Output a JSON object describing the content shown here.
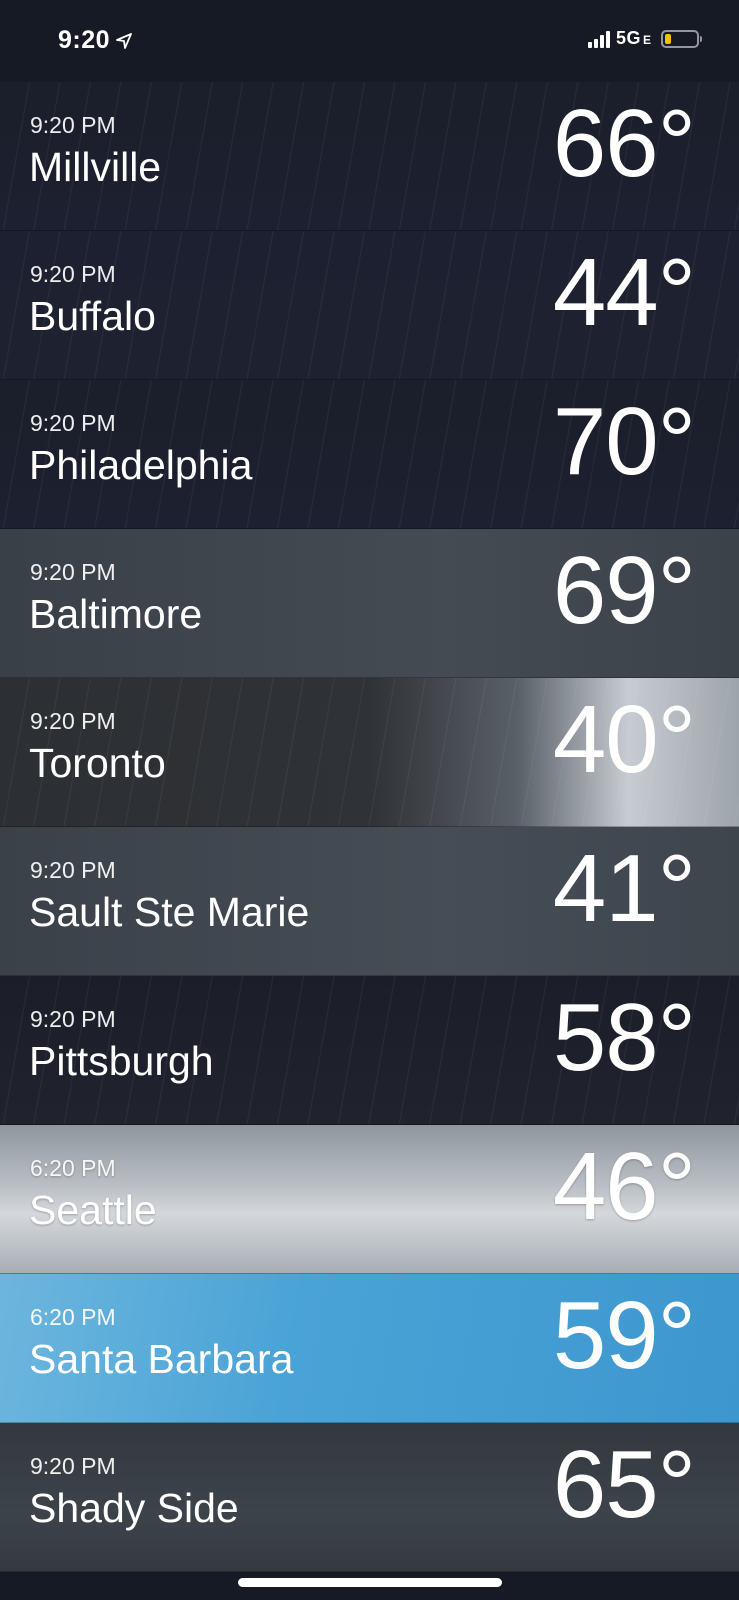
{
  "status_bar": {
    "time": "9:20",
    "network": "5G",
    "network_sub": "E",
    "battery_color": "#f2c200",
    "location_icon": "location-arrow-icon"
  },
  "cities": [
    {
      "time": "9:20 PM",
      "name": "Millville",
      "temp": "66°",
      "condition": "night-rain"
    },
    {
      "time": "9:20 PM",
      "name": "Buffalo",
      "temp": "44°",
      "condition": "night-rain"
    },
    {
      "time": "9:20 PM",
      "name": "Philadelphia",
      "temp": "70°",
      "condition": "night-rain"
    },
    {
      "time": "9:20 PM",
      "name": "Baltimore",
      "temp": "69°",
      "condition": "overcast"
    },
    {
      "time": "9:20 PM",
      "name": "Toronto",
      "temp": "40°",
      "condition": "storm-clouds"
    },
    {
      "time": "9:20 PM",
      "name": "Sault Ste Marie",
      "temp": "41°",
      "condition": "overcast"
    },
    {
      "time": "9:20 PM",
      "name": "Pittsburgh",
      "temp": "58°",
      "condition": "night-rain"
    },
    {
      "time": "6:20 PM",
      "name": "Seattle",
      "temp": "46°",
      "condition": "cloudy"
    },
    {
      "time": "6:20 PM",
      "name": "Santa Barbara",
      "temp": "59°",
      "condition": "clear-day"
    },
    {
      "time": "9:20 PM",
      "name": "Shady Side",
      "temp": "65°",
      "condition": "overcast-night"
    }
  ]
}
